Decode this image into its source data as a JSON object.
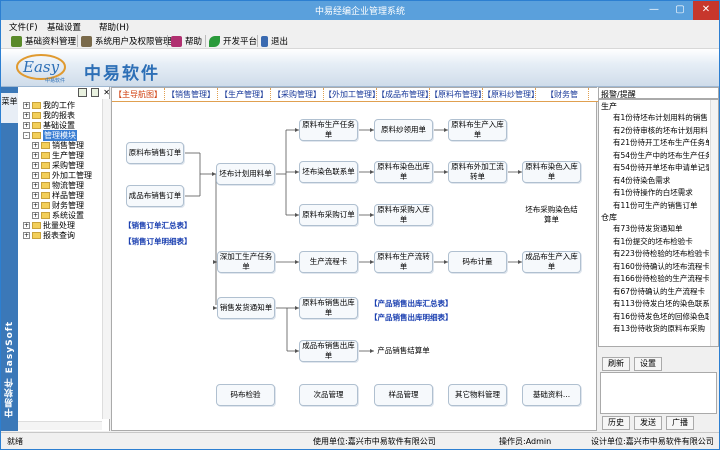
{
  "window": {
    "title": "中易经编企业管理系统",
    "controls": [
      "—",
      "▢",
      "✕"
    ]
  },
  "menu": [
    "文件(F)",
    "基础设置",
    "帮助(H)"
  ],
  "toolbar": [
    {
      "label": "基础资料管理",
      "icon": "database-icon",
      "color": "#5a8a2a"
    },
    {
      "label": "系统用户及权限管理",
      "icon": "users-icon",
      "color": "#7a6a4a"
    },
    {
      "label": "帮助",
      "icon": "book-icon",
      "color": "#b03070"
    },
    {
      "label": "开发平台",
      "icon": "leaf-icon",
      "color": "#2a9a3a"
    },
    {
      "label": "退出",
      "icon": "exit-icon",
      "color": "#3a6ab0"
    }
  ],
  "banner": {
    "logo_text": "Easy",
    "logo_sub": "中易软件",
    "brand": "中易软件"
  },
  "left_strip": {
    "tab": "菜单",
    "vertical": "中易软件 EasySoft"
  },
  "tree": [
    {
      "label": "我的工作",
      "level": 0,
      "exp": "+"
    },
    {
      "label": "我的报表",
      "level": 0,
      "exp": "+"
    },
    {
      "label": "基础设置",
      "level": 0,
      "exp": "+"
    },
    {
      "label": "管理模块",
      "level": 0,
      "exp": "-",
      "selected": true
    },
    {
      "label": "销售管理",
      "level": 1,
      "exp": "+"
    },
    {
      "label": "生产管理",
      "level": 1,
      "exp": "+"
    },
    {
      "label": "采购管理",
      "level": 1,
      "exp": "+"
    },
    {
      "label": "外加工管理",
      "level": 1,
      "exp": "+"
    },
    {
      "label": "物流管理",
      "level": 1,
      "exp": "+"
    },
    {
      "label": "样品管理",
      "level": 1,
      "exp": "+"
    },
    {
      "label": "财务管理",
      "level": 1,
      "exp": "+"
    },
    {
      "label": "系统设置",
      "level": 1,
      "exp": "+"
    },
    {
      "label": "批量处理",
      "level": 0,
      "exp": "+"
    },
    {
      "label": "报表查询",
      "level": 0,
      "exp": "+"
    }
  ],
  "tabs": [
    "【主导航图】",
    "【销售管理】",
    "【生产管理】",
    "【采购管理】",
    "【外加工管理】",
    "【成品布管理】",
    "【原料布管理】",
    "【原料纱管理】",
    "【财务管"
  ],
  "flow": {
    "boxes": {
      "yl_xs": "原料布销售订单",
      "cp_xs": "成品布销售订单",
      "ppjh": "坯布计划用料单",
      "ylrw": "原料布生产任务单",
      "yls_ll": "原料纱领用单",
      "rk1": "原料布生产入库单",
      "rsl": "坯布染色联系单",
      "ylrs": "原料布染色出库单",
      "wjg": "原料布外加工流转单",
      "rsrk": "原料布染色入库单",
      "cgdd": "原料布采购订单",
      "cgrk": "原料布采购入库单",
      "jsd": "坯布采购染色结算单",
      "sjg": "深加工生产任务单",
      "lck": "生产流程卡",
      "cplz": "原料布生产流转单",
      "mbjl": "码布计量",
      "cprk": "成品布生产入库单",
      "fh": "销售发货通知单",
      "ylxs_ck": "原料布销售出库单",
      "cpxs_ck": "成品布销售出库单",
      "cpjs": "产品销售结算单",
      "mbjy": "码布检验",
      "cpgl": "次品管理",
      "ypgl": "样品管理",
      "qtwl": "其它物料管理",
      "jczl": "基础资料..."
    },
    "links": {
      "xs_hz": "【销售订单汇总表】",
      "xs_mx": "【销售订单明细表】",
      "ck_hz": "【产品销售出库汇总表】",
      "ck_mx": "【产品销售出库明细表】"
    }
  },
  "right": {
    "title": "报警/提醒",
    "sections": [
      {
        "header": "生产",
        "items": [
          "有1份待坯布计划用料的销售",
          "有2份待审核的坯布计划用料",
          "有21份待开工坯布生产任务单",
          "有54份生产中的坯布生产任务",
          "有54份待开单坯布申请单记录",
          "有4份待染色需求",
          "有1份待操作的白坯需求",
          "有11份可生产的销售订单"
        ]
      },
      {
        "header": "仓库",
        "items": [
          "有73份待发货通知单",
          "有1份提交的坯布检验卡",
          "有223份待检验的坯布检验卡",
          "有160份待确认的坯布流程卡",
          "有166份待检验的生产流程卡",
          "有67份待确认的生产流程卡",
          "有113份待发白坯的染色联系",
          "有16份待发色坯的回修染色联",
          "有13份待收货的原料布采购"
        ]
      }
    ],
    "buttons": {
      "refresh": "刷新",
      "settings": "设置",
      "history": "历史",
      "send": "发送",
      "broadcast": "广播"
    }
  },
  "status": {
    "ready": "就绪",
    "user_unit": "使用单位:嘉兴市中易软件有限公司",
    "operator": "操作员:Admin",
    "designer": "设计单位:嘉兴市中易软件有限公司"
  }
}
